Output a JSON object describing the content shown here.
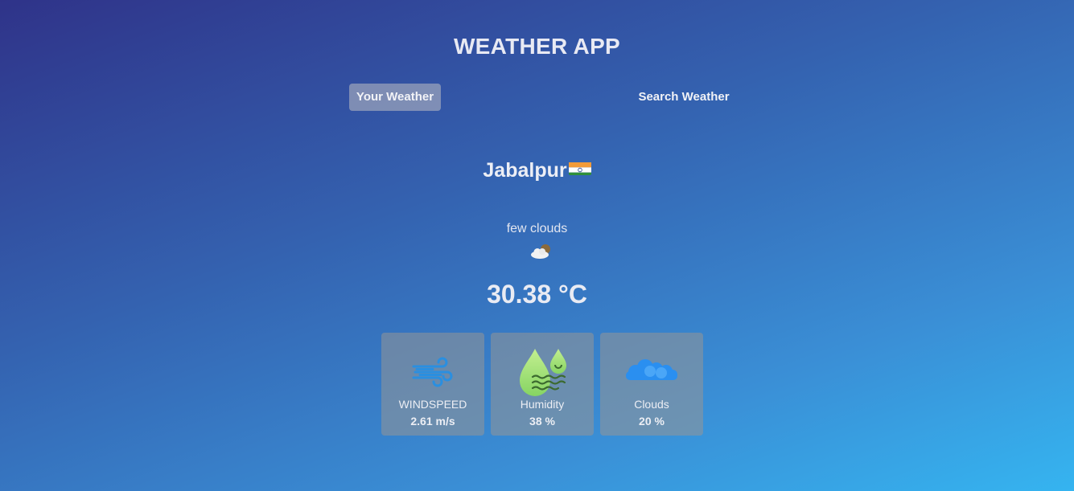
{
  "app": {
    "title": "WEATHER APP"
  },
  "tabs": [
    {
      "label": "Your Weather",
      "active": true
    },
    {
      "label": "Search Weather",
      "active": false
    }
  ],
  "weather": {
    "city": "Jabalpur",
    "country_flag": "india-flag-icon",
    "description": "few clouds",
    "condition_icon": "few-clouds-icon",
    "temperature": "30.38 °C"
  },
  "stats": [
    {
      "icon": "wind-icon",
      "label": "WINDSPEED",
      "value": "2.61 m/s"
    },
    {
      "icon": "humidity-icon",
      "label": "Humidity",
      "value": "38 %"
    },
    {
      "icon": "clouds-icon",
      "label": "Clouds",
      "value": "20 %"
    }
  ],
  "colors": {
    "bg_start": "#2f3389",
    "bg_end": "#35b4f0",
    "card_bg": "#8a8f9a",
    "wind_icon": "#2a8fe0",
    "humidity_icon": "#a6e07a",
    "clouds_icon": "#2a8ff0"
  }
}
